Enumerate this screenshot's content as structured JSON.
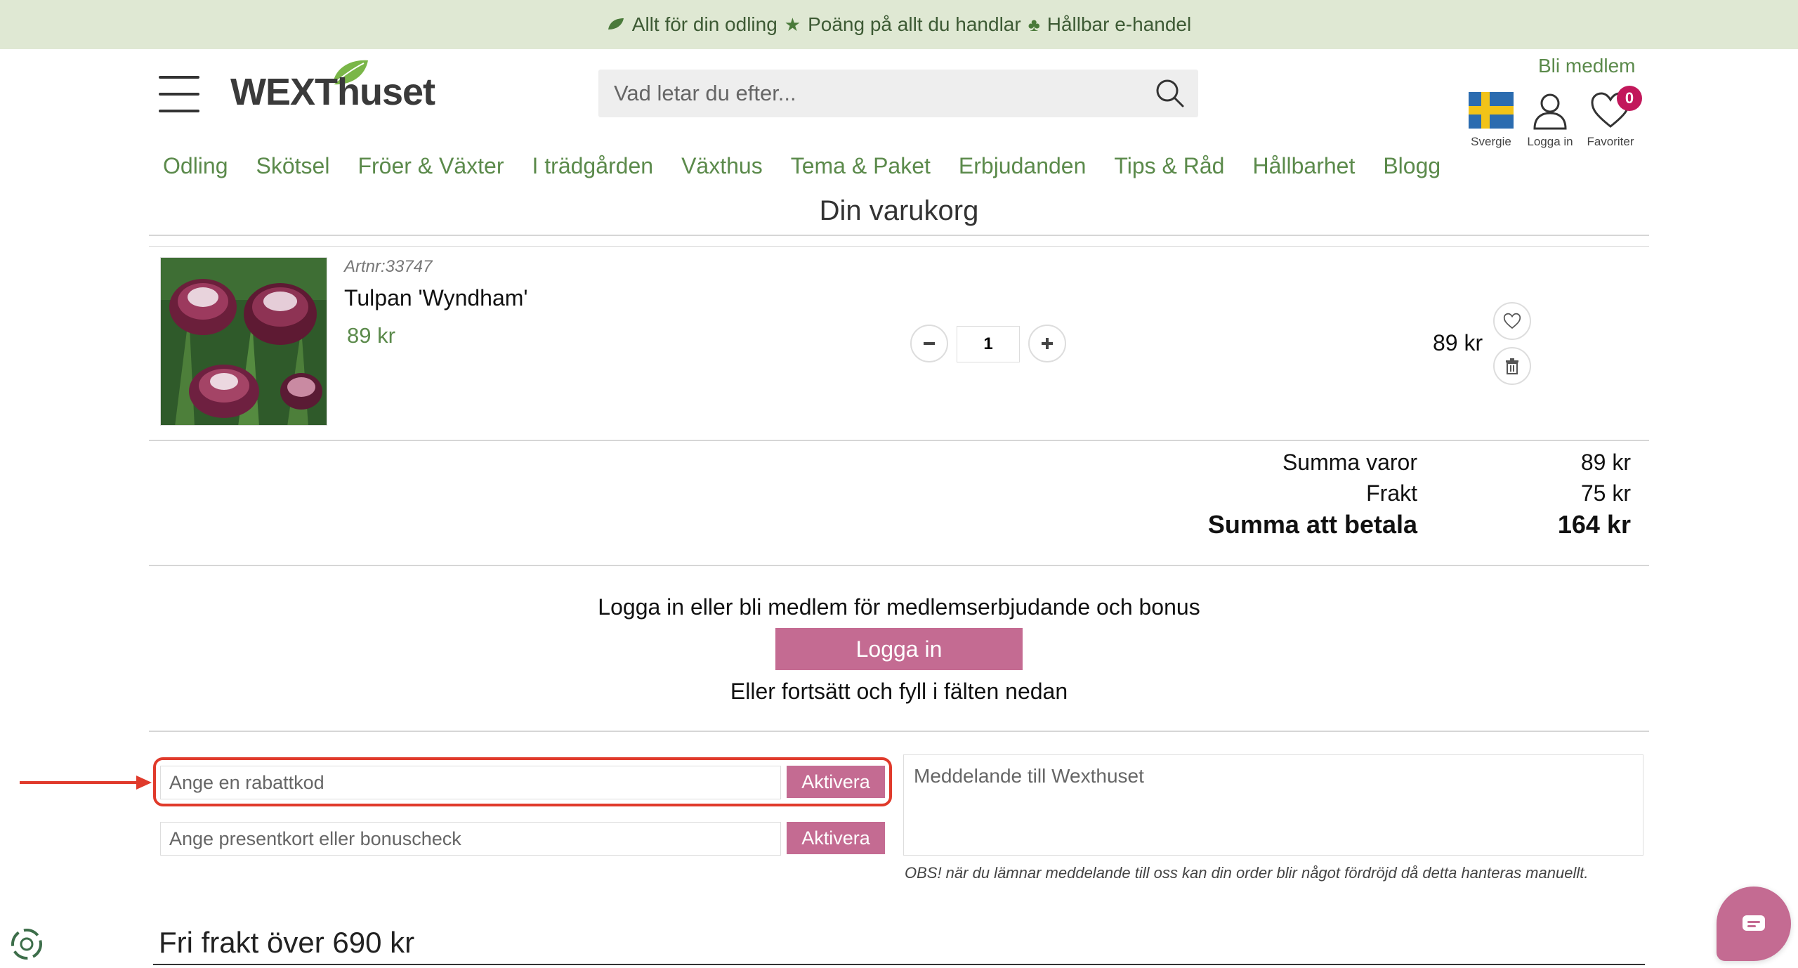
{
  "topbar": {
    "item1": "Allt för din odling",
    "item2": "Poäng på allt du handlar",
    "item3": "Hållbar e-handel"
  },
  "header": {
    "logo_text": "WEXThuset",
    "search_placeholder": "Vad letar du efter...",
    "bli_medlem": "Bli medlem",
    "country_label": "Svergie",
    "login_label": "Logga in",
    "favorites_label": "Favoriter",
    "favorites_count": "0"
  },
  "nav": {
    "items": [
      "Odling",
      "Skötsel",
      "Fröer & Växter",
      "I trädgården",
      "Växthus",
      "Tema & Paket",
      "Erbjudanden",
      "Tips & Råd",
      "Hållbarhet",
      "Blogg"
    ]
  },
  "cart": {
    "title": "Din varukorg",
    "item": {
      "artnr": "Artnr:33747",
      "name": "Tulpan 'Wyndham'",
      "price": "89 kr",
      "quantity": "1",
      "line_total": "89 kr"
    },
    "summary": {
      "subtotal_label": "Summa varor",
      "subtotal_value": "89 kr",
      "shipping_label": "Frakt",
      "shipping_value": "75 kr",
      "total_label": "Summa att betala",
      "total_value": "164 kr"
    }
  },
  "login": {
    "prompt": "Logga in eller bli medlem för medlemserbjudande och bonus",
    "button": "Logga in",
    "alt_text": "Eller fortsätt och fyll i fälten nedan"
  },
  "codes": {
    "discount_placeholder": "Ange en rabattkod",
    "gift_placeholder": "Ange presentkort eller bonuscheck",
    "activate_label": "Aktivera"
  },
  "message": {
    "placeholder": "Meddelande till Wexthuset",
    "note": "OBS! när du lämnar meddelande till oss kan din order blir något fördröjd då detta hanteras manuellt."
  },
  "footer": {
    "free_shipping": "Fri frakt över 690 kr"
  },
  "colors": {
    "accent_green": "#5b8a4b",
    "button_pink": "#c46b92",
    "highlight_red": "#e03a2b",
    "topbar_bg": "#dfe8d3"
  }
}
